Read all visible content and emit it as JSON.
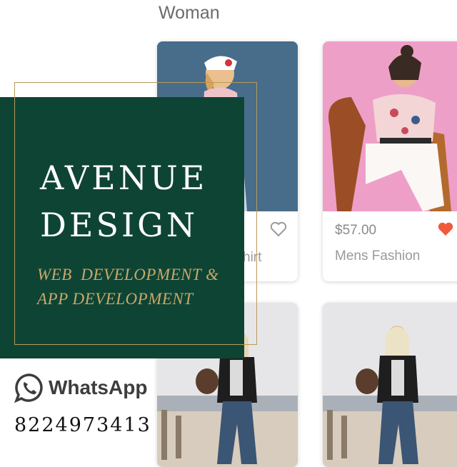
{
  "section": {
    "title": "Woman"
  },
  "products": [
    {
      "price": "",
      "name": "hirt",
      "favorited": false
    },
    {
      "price": "$57.00",
      "name": "Mens Fashion",
      "favorited": true
    },
    {
      "price": "",
      "name": "",
      "favorited": false
    },
    {
      "price": "",
      "name": "",
      "favorited": false
    }
  ],
  "brand": {
    "line1": "AVENUE",
    "line2": "DESIGN",
    "sub1": "WEB  DEVELOPMENT &",
    "sub2": "APP DEVELOPMENT"
  },
  "contact": {
    "whatsapp_label": "WhatsApp",
    "phone": "8224973413"
  },
  "colors": {
    "panel": "#0e4434",
    "gold": "#c9a86a",
    "heart_active": "#f05a3c"
  }
}
